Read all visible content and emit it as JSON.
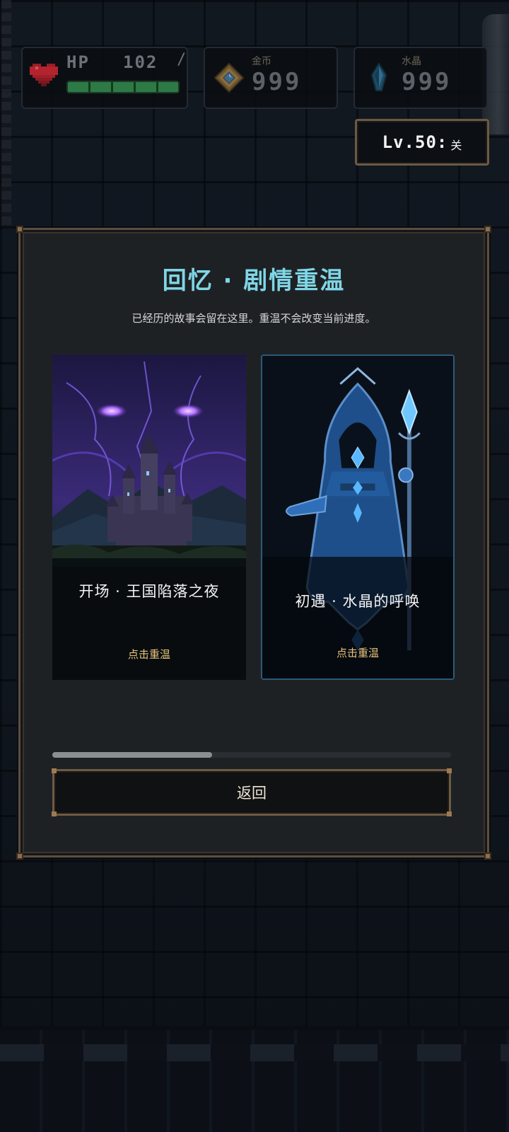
{
  "hud": {
    "hp_label": "HP",
    "hp_value": "102",
    "hp_slash": "/",
    "hp_fraction": 1.0,
    "gold_label": "金币",
    "gold_value": "999",
    "crystal_label": "水晶",
    "crystal_value": "999",
    "level_text": "Lv.50:",
    "level_suffix": "关"
  },
  "memory_panel": {
    "title": "回忆 · 剧情重温",
    "subtitle": "已经历的故事会留在这里。重温不会改变当前进度。",
    "cards": [
      {
        "title": "开场 · 王国陷落之夜",
        "action": "点击重温",
        "art": "castle-storm-art"
      },
      {
        "title": "初遇 · 水晶的呼唤",
        "action": "点击重温",
        "art": "hooded-mage-art"
      }
    ],
    "scroll_fraction": 0.4,
    "back_label": "返回"
  },
  "colors": {
    "title": "#7fd6e6",
    "action": "#e7c57a",
    "frame": "#6e5a43",
    "hp_fill": "#2d7a46"
  }
}
